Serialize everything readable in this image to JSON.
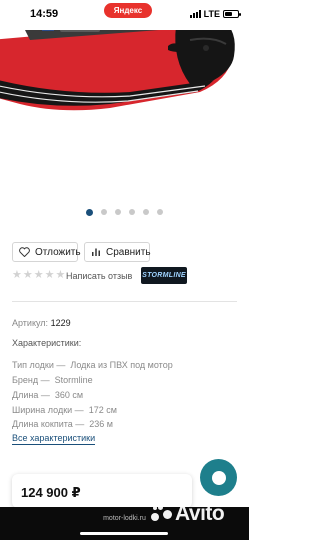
{
  "status_bar": {
    "time": "14:59",
    "browser_pill": "Яндекс",
    "network": "LTE",
    "battery_level": 0.6
  },
  "gallery": {
    "slide_count": 6,
    "active_index": 0
  },
  "actions": {
    "favorite_label": "Отложить",
    "compare_label": "Сравнить"
  },
  "rating": {
    "stars_filled": 0,
    "stars_total": 5,
    "review_link": "Написать отзыв"
  },
  "brand_logo_text": "STORMLINE",
  "article": {
    "label": "Артикул:",
    "value": "1229"
  },
  "specs": {
    "title": "Характеристики:",
    "items": [
      {
        "label": "Тип лодки —",
        "value": "Лодка из ПВХ под мотор"
      },
      {
        "label": "Бренд —",
        "value": "Stormline"
      },
      {
        "label": "Длина —",
        "value": "360 см"
      },
      {
        "label": "Ширина лодки —",
        "value": "172 см"
      },
      {
        "label": "Длина кокпита —",
        "value": "236 м"
      }
    ],
    "all_link": "Все характеристики"
  },
  "price": "124 900 ₽",
  "footer": {
    "url": "motor-lodki.ru"
  },
  "watermark_text": "Avito",
  "colors": {
    "boat_red": "#d7262d",
    "active_dot": "#1a4f7a",
    "chat_button": "#1e7f8c",
    "link": "#1a4f7a"
  }
}
